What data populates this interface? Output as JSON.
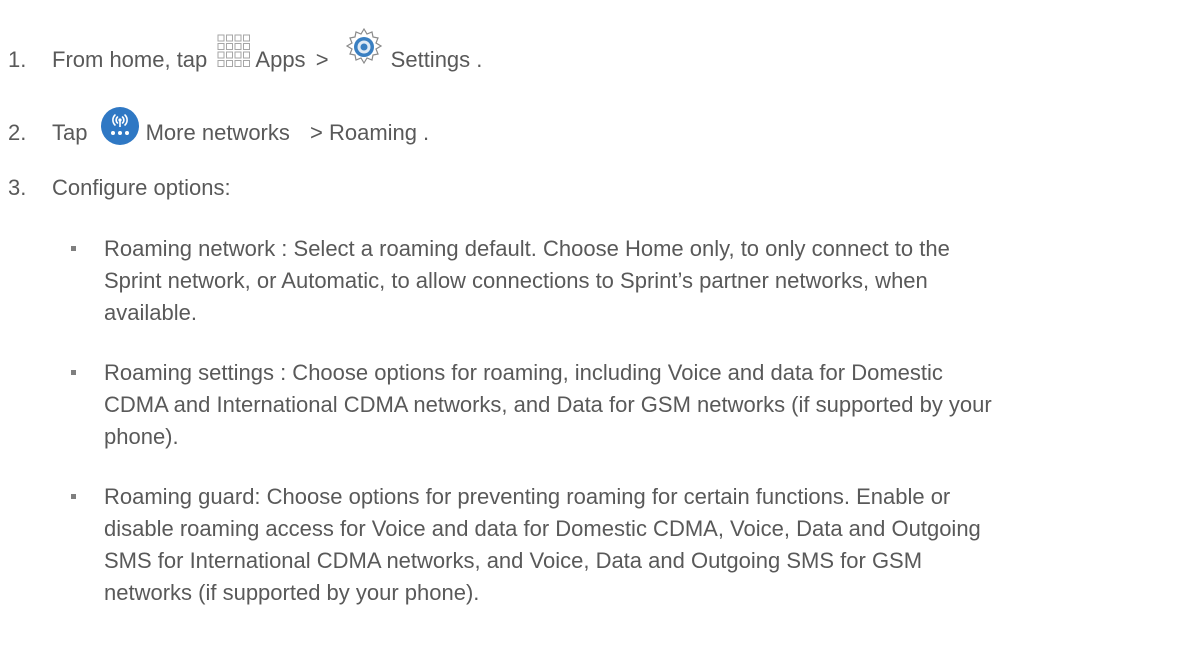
{
  "steps": [
    {
      "number": "1.",
      "text_before": "From home, tap",
      "icon1": "apps-grid-icon",
      "label1": "Apps",
      "separator": ">",
      "icon2": "settings-gear-icon",
      "label2": "Settings",
      "text_after": "."
    },
    {
      "number": "2.",
      "text_before": "Tap",
      "icon1": "more-networks-icon",
      "label1": "More networks",
      "separator": "> Roaming",
      "text_after": "."
    },
    {
      "number": "3.",
      "text": "Configure options:"
    }
  ],
  "options": [
    {
      "lines": [
        "Roaming network  : Select a roaming default. Choose Home only, to only connect to the",
        "Sprint network, or Automatic, to allow connections to Sprint’s partner  networks, when",
        "available."
      ]
    },
    {
      "lines": [
        "Roaming settings  : Choose options for roaming, including Voice and data for Domestic",
        "CDMA and International CDMA networks, and Data for GSM networks (if supported by your",
        "phone)."
      ]
    },
    {
      "lines": [
        "Roaming guard: Choose options for preventing roaming for certain functions. Enable or",
        "disable roaming access for Voice and data for Domestic CDMA, Voice, Data and Outgoing",
        "SMS for International CDMA networks, and Voice, Data and Outgoing SMS for GSM",
        "networks (if supported by your phone)."
      ]
    }
  ],
  "colors": {
    "text": "#595959",
    "bullet": "#7f7f7f",
    "apps_icon": "#a6a6a6",
    "settings_icon": "#3a7fc1",
    "morenet_icon": "#2f78c4"
  }
}
